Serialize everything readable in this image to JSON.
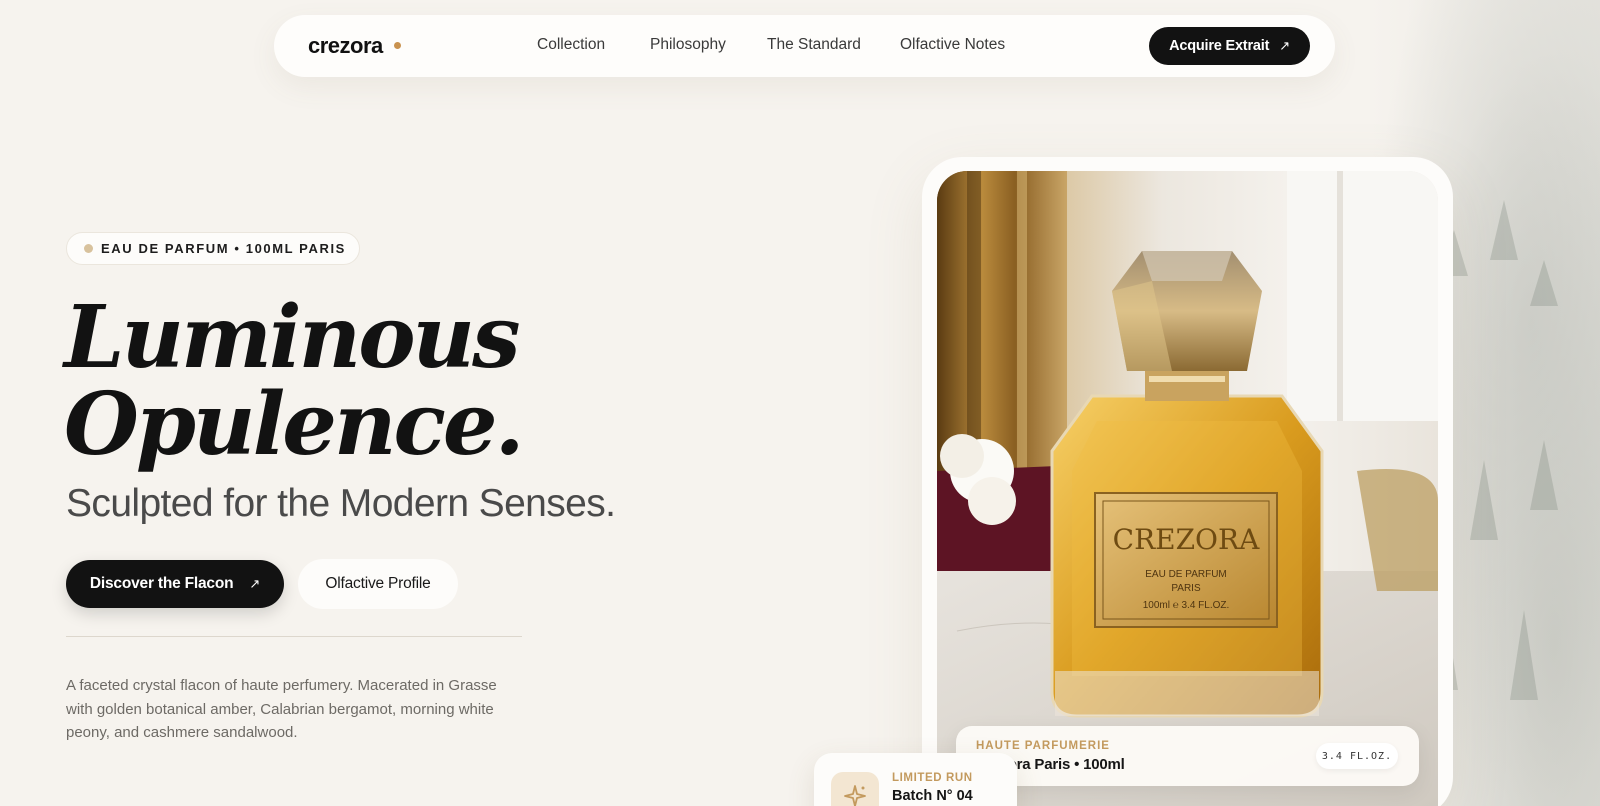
{
  "nav": {
    "logo": "crezora",
    "links": [
      "Collection",
      "Philosophy",
      "The Standard",
      "Olfactive Notes"
    ],
    "cta_label": "Acquire Extrait",
    "cta_icon": "arrow-up-right-icon"
  },
  "hero": {
    "badge": "EAU DE PARFUM • 100ML PARIS",
    "headline_line1": "Luminous",
    "headline_line2": "Opulence.",
    "subheadline": "Sculpted for the Modern Senses.",
    "primary_button": "Discover the Flacon",
    "secondary_button": "Olfactive Profile",
    "description": "A faceted crystal flacon of haute perfumery. Macerated in Grasse with golden botanical amber, Calabrian bergamot, morning white peony, and cashmere sandalwood."
  },
  "product": {
    "label_brand": "CREZORA",
    "label_line1": "EAU DE PARFUM",
    "label_line2": "PARIS",
    "label_line3": "100ml ℮ 3.4 FL.OZ.",
    "info_eyebrow": "HAUTE PARFUMERIE",
    "info_title": "Crezora Paris • 100ml",
    "info_chip": "3.4 FL.OZ.",
    "limited_eyebrow": "LIMITED RUN",
    "limited_title": "Batch N° 04",
    "limited_icon": "sparkle-icon"
  },
  "colors": {
    "background": "#f6f3ee",
    "accent_gold": "#c39a5e",
    "dark": "#121212"
  }
}
